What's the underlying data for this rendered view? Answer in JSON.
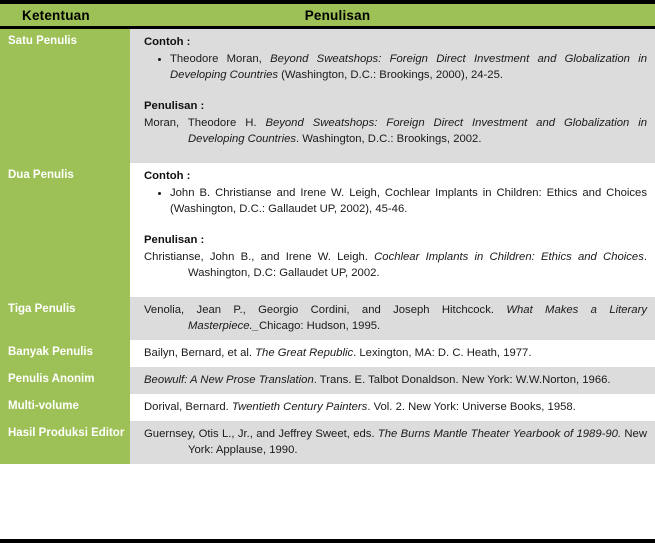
{
  "table": {
    "header": {
      "col1": "Ketentuan",
      "col2": "Penulisan"
    },
    "labels": {
      "contoh": "Contoh :",
      "penulisan": "Penulisan :"
    },
    "rows": [
      {
        "label": "Satu Penulis",
        "shade": "gray",
        "contoh_label": "Contoh :",
        "contoh_items": [
          {
            "pre": "Theodore Moran, ",
            "italic": "Beyond Sweatshops: Foreign Direct Investment and Globalization in Developing Countries",
            "post": " (Washington, D.C.: Brookings, 2000), 24-25."
          }
        ],
        "penulisan_label": "Penulisan :",
        "penulisan": {
          "pre": "Moran, Theodore H. ",
          "italic": "Beyond Sweatshops: Foreign Direct Investment and Globalization in Developing Countries",
          "post": ". Washington, D.C.: Brookings, 2002."
        }
      },
      {
        "label": "Dua Penulis",
        "shade": "white",
        "contoh_label": "Contoh :",
        "contoh_items": [
          {
            "pre": "John B. Christianse and Irene W. Leigh, Cochlear Implants in Children: Ethics and Choices (Washington, D.C.: Gallaudet UP, 2002), 45-46.",
            "italic": "",
            "post": ""
          }
        ],
        "penulisan_label": "Penulisan :",
        "penulisan": {
          "pre": "Christianse, John B., and Irene W. Leigh. ",
          "italic": "Cochlear Implants in Children: Ethics and Choices",
          "post": ". Washington, D.C: Gallaudet UP, 2002."
        }
      },
      {
        "label": "Tiga Penulis",
        "shade": "gray",
        "entry": {
          "pre": "Venolia, Jean P., Georgio Cordini, and Joseph Hitchcock. ",
          "italic": "What Makes a Literary Masterpiece._",
          "post": "Chicago: Hudson, 1995."
        }
      },
      {
        "label": "Banyak Penulis",
        "shade": "white",
        "entry": {
          "pre": "Bailyn, Bernard, et al. ",
          "italic": "The Great Republic",
          "post": ". Lexington, MA: D. C. Heath, 1977."
        }
      },
      {
        "label": "Penulis Anonim",
        "shade": "gray",
        "entry": {
          "pre": "",
          "italic": "Beowulf: A New Prose Translation",
          "post": ". Trans. E. Talbot Donaldson. New York: W.W.Norton, 1966."
        }
      },
      {
        "label": "Multi-volume",
        "shade": "white",
        "entry": {
          "pre": "Dorival, Bernard. ",
          "italic": "Twentieth Century Painters",
          "post": ". Vol. 2. New York: Universe Books, 1958."
        }
      },
      {
        "label": "Hasil Produksi Editor",
        "shade": "gray",
        "entry": {
          "pre": "Guernsey, Otis L., Jr., and Jeffrey Sweet, eds. ",
          "italic": "The Burns Mantle Theater Yearbook of 1989-90.",
          "post": " New York: Applause, 1990."
        }
      }
    ]
  },
  "colors": {
    "green": "#9dc156",
    "row_gray": "#dcdcdc",
    "row_white": "#ffffff",
    "border": "#000000"
  }
}
